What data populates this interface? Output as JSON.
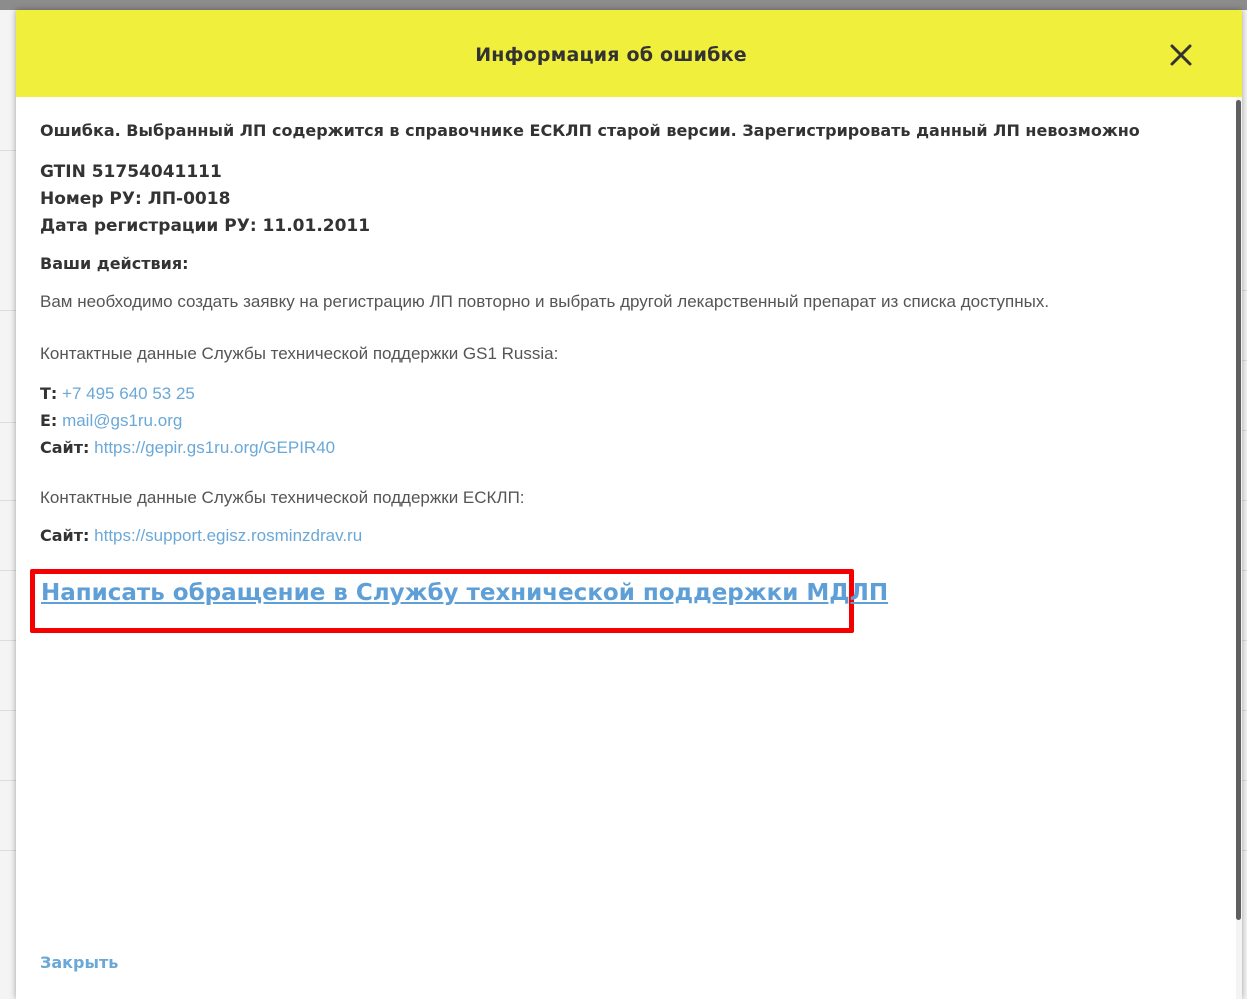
{
  "dialog": {
    "title": "Информация об ошибке",
    "close_icon": "close-icon"
  },
  "error": {
    "message": "Ошибка. Выбранный ЛП содержится в справочнике ЕСКЛП старой версии. Зарегистрировать данный ЛП невозможно",
    "gtin": "GTIN 51754041111",
    "ru_number": "Номер РУ: ЛП-0018",
    "ru_date": "Дата регистрации РУ: 11.01.2011"
  },
  "actions": {
    "title": "Ваши действия:",
    "text": "Вам необходимо создать заявку на регистрацию ЛП повторно и выбрать другой лекарственный препарат из списка доступных."
  },
  "gs1_support": {
    "heading": "Контактные данные Службы технической поддержки GS1 Russia:",
    "phone_label": "Т:",
    "phone": "+7 495 640 53 25",
    "email_label": "E:",
    "email": "mail@gs1ru.org",
    "site_label": "Сайт:",
    "site": "https://gepir.gs1ru.org/GEPIR40"
  },
  "esklp_support": {
    "heading": "Контактные данные Службы технической поддержки ЕСКЛП:",
    "site_label": "Сайт:",
    "site": "https://support.egisz.rosminzdrav.ru"
  },
  "mdlp_link": "Написать обращение в Службу технической поддержки МДЛП",
  "footer": {
    "close_label": "Закрыть"
  },
  "colors": {
    "header_bg": "#f0ef3c",
    "link": "#6aa8d8",
    "highlight": "#f40000"
  }
}
